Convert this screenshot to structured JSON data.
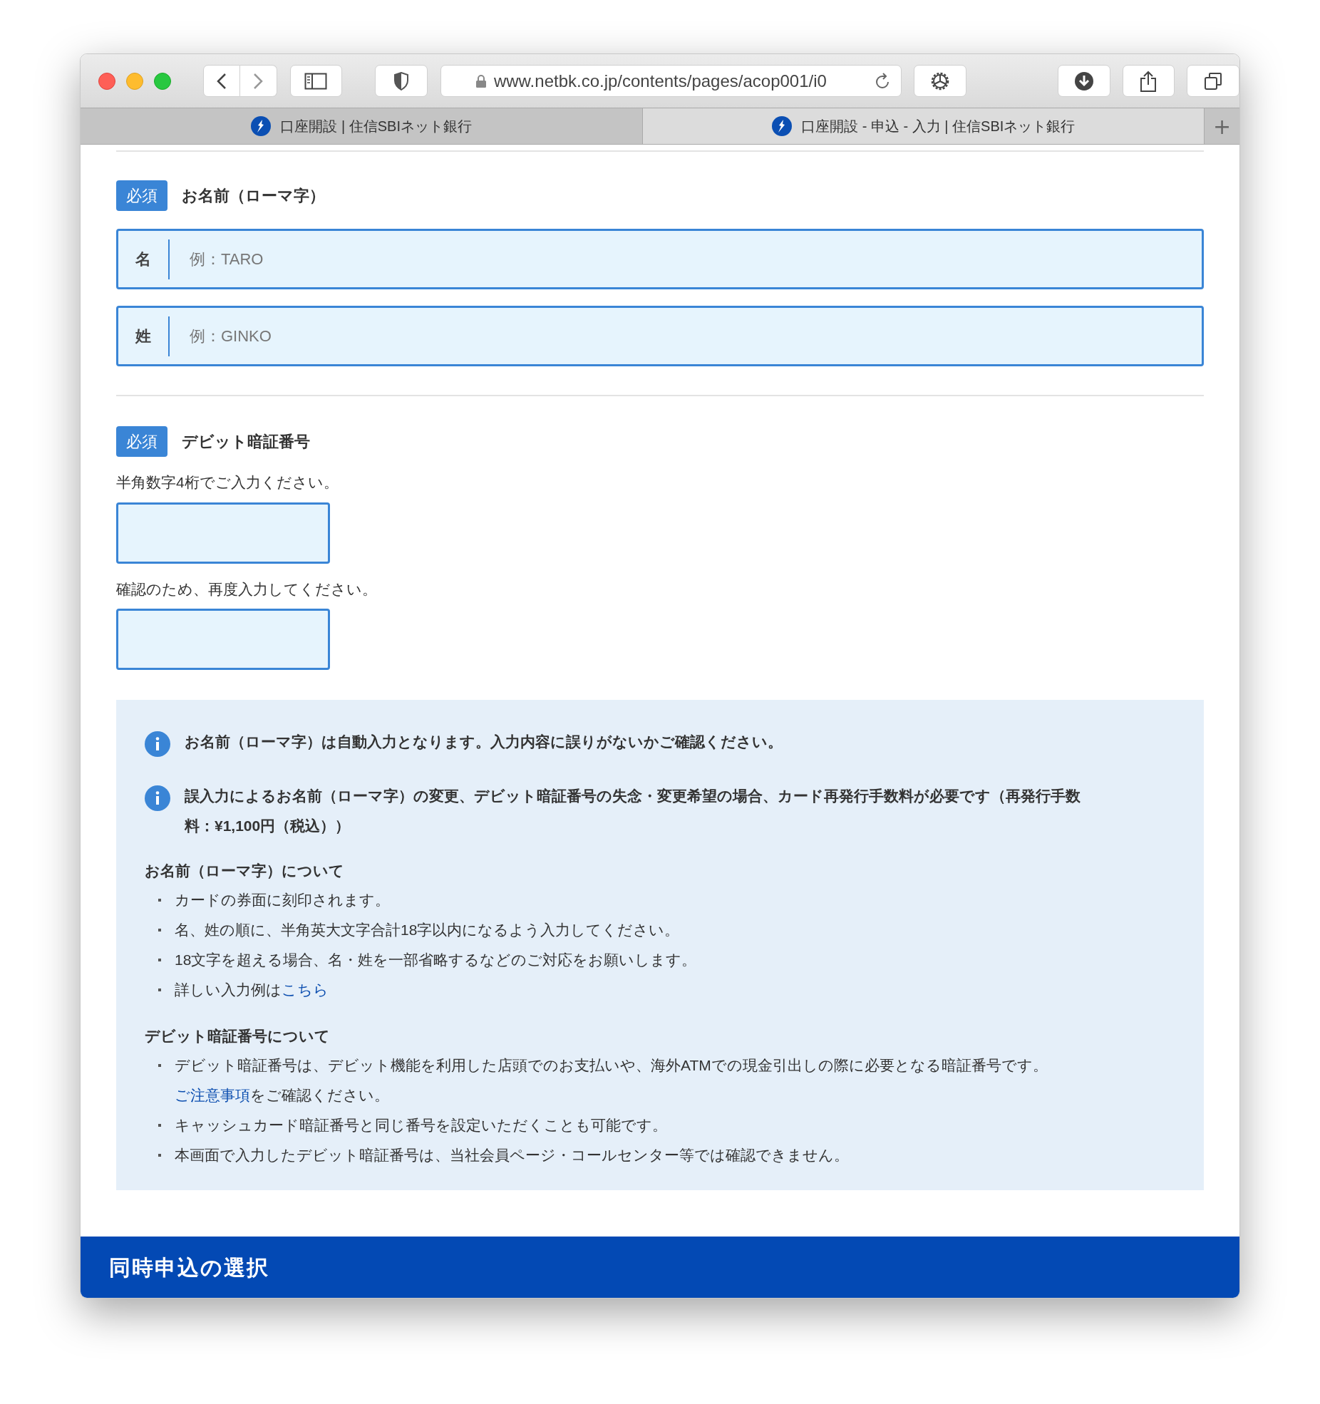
{
  "browser": {
    "url": "www.netbk.co.jp/contents/pages/acop001/i0",
    "tabs": [
      {
        "title": "口座開設 | 住信SBIネット銀行",
        "selected": false
      },
      {
        "title": "口座開設 - 申込 - 入力 | 住信SBIネット銀行",
        "selected": true
      }
    ],
    "new_tab": "+"
  },
  "name_section": {
    "badge": "必須",
    "label": "お名前（ローマ字）",
    "fields": [
      {
        "label": "名",
        "placeholder": "例：TARO"
      },
      {
        "label": "姓",
        "placeholder": "例：GINKO"
      }
    ]
  },
  "pin_section": {
    "badge": "必須",
    "label": "デビット暗証番号",
    "fields": [
      {
        "hint": "半角数字4桁でご入力ください。"
      },
      {
        "hint": "確認のため、再度入力してください。"
      }
    ]
  },
  "notices": [
    "お名前（ローマ字）は自動入力となります。入力内容に誤りがないかご確認ください。",
    "誤入力によるお名前（ローマ字）の変更、デビット暗証番号の失念・変更希望の場合、カード再発行手数料が必要です（再発行手数料：¥1,100円（税込））"
  ],
  "notes": [
    {
      "heading": "お名前（ローマ字）について",
      "items": [
        {
          "text": "カードの券面に刻印されます。"
        },
        {
          "text": "名、姓の順に、半角英大文字合計18字以内になるよう入力してください。"
        },
        {
          "text": "18文字を超える場合、名・姓を一部省略するなどのご対応をお願いします。"
        },
        {
          "text": "詳しい入力例は",
          "link": "こちら"
        }
      ]
    },
    {
      "heading": "デビット暗証番号について",
      "items": [
        {
          "text": "デビット暗証番号は、デビット機能を利用した店頭でのお支払いや、海外ATMでの現金引出しの際に必要となる暗証番号です。",
          "link": "ご注意事項",
          "link_on_new_line": true,
          "after": "をご確認ください。"
        },
        {
          "text": "キャッシュカード暗証番号と同じ番号を設定いただくことも可能です。"
        },
        {
          "text": "本画面で入力したデビット暗証番号は、当社会員ページ・コールセンター等では確認できません。"
        }
      ]
    }
  ],
  "next_section": {
    "title": "同時申込の選択"
  }
}
